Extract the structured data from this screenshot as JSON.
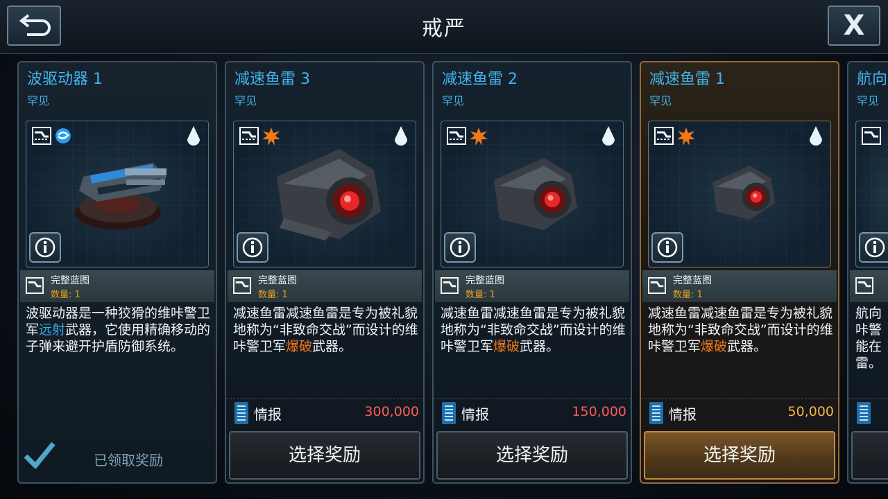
{
  "header": {
    "title": "戒严",
    "close_label": "X"
  },
  "cards": [
    {
      "name": "波驱动器 1",
      "rarity": "罕见",
      "type_color": "#2a9cf0",
      "blueprint": {
        "title": "完整蓝图",
        "qty": "数量: 1"
      },
      "desc_parts": [
        "波驱动器是一种狡猾的维咔警卫军",
        "远射",
        "武器，它使用精确移动的子弹来避开护盾防御系统。"
      ],
      "claimed_label": "已领取奖励"
    },
    {
      "name": "减速鱼雷 3",
      "rarity": "罕见",
      "type_color": "#f07818",
      "blueprint": {
        "title": "完整蓝图",
        "qty": "数量: 1"
      },
      "desc_parts": [
        "减速鱼雷减速鱼雷是专为被礼貌地称为“非致命交战”而设计的维咔警卫军",
        "爆破",
        "武器。"
      ],
      "intel_label": "情报",
      "cost": "300,000",
      "select_label": "选择奖励"
    },
    {
      "name": "减速鱼雷 2",
      "rarity": "罕见",
      "type_color": "#f07818",
      "blueprint": {
        "title": "完整蓝图",
        "qty": "数量: 1"
      },
      "desc_parts": [
        "减速鱼雷减速鱼雷是专为被礼貌地称为“非致命交战”而设计的维咔警卫军",
        "爆破",
        "武器。"
      ],
      "intel_label": "情报",
      "cost": "150,000",
      "select_label": "选择奖励"
    },
    {
      "name": "减速鱼雷 1",
      "rarity": "罕见",
      "type_color": "#f07818",
      "blueprint": {
        "title": "完整蓝图",
        "qty": "数量: 1"
      },
      "desc_parts": [
        "减速鱼雷减速鱼雷是专为被礼貌地称为“非致命交战”而设计的维咔警卫军",
        "爆破",
        "武器。"
      ],
      "intel_label": "情报",
      "cost": "50,000",
      "select_label": "选择奖励"
    },
    {
      "name": "航向",
      "rarity": "罕见",
      "desc_lines": [
        "航向",
        "咔警",
        "能在",
        "雷。"
      ]
    }
  ],
  "colors": {
    "rare_blue": "#41b4ee",
    "cost_red": "#ff5a5a",
    "cost_gold": "#f0b840",
    "selected_border": "#9a6a33"
  },
  "icons": [
    "back-arrow-icon",
    "close-icon",
    "blueprint-icon",
    "wave-icon",
    "explosive-icon",
    "drop-icon",
    "info-icon",
    "intel-icon",
    "check-icon"
  ]
}
